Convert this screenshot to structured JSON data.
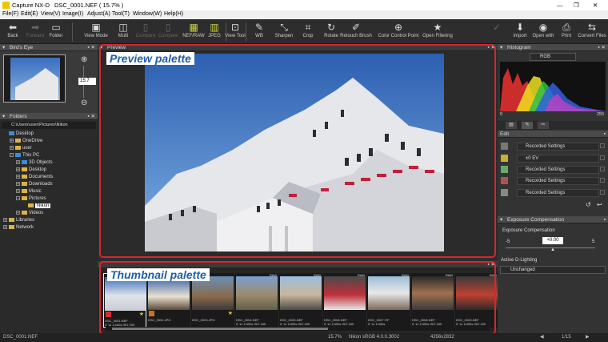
{
  "window": {
    "title": "Capture NX-D",
    "file_title": "DSC_0001.NEF ( 15.7% )",
    "controls": [
      "—",
      "❐",
      "✕"
    ]
  },
  "menu": [
    "File(F)",
    "Edit(E)",
    "View(V)",
    "Image(I)",
    "Adjust(A)",
    "Tool(T)",
    "Window(W)",
    "Help(H)"
  ],
  "toolbar": {
    "back": "Back",
    "forward": "Forward",
    "folder": "Folder",
    "view_mode": "View Mode",
    "multi": "Multi",
    "compare1": "Compare",
    "compare2": "Compare",
    "before_after": "NEF/RAW",
    "jpeg": "JPEG",
    "view_tool": "View Tool",
    "wb": "WB",
    "sharpen": "Sharpen",
    "crop": "Crop",
    "rotate": "Rotate",
    "retouch": "Retouch Brush",
    "color_control": "Color Control Point",
    "open_filtering": "Open Filtering",
    "import": "Import",
    "open_with": "Open with",
    "print": "Print",
    "convert": "Convert Files"
  },
  "birds_eye": {
    "title": "Bird's Eye",
    "zoom": "15.7"
  },
  "folders": {
    "title": "Folders",
    "path": "C:\\Users\\user\\Pictures\\Nikon",
    "tree": [
      {
        "label": "Desktop",
        "indent": 0,
        "exp": "",
        "blue": true
      },
      {
        "label": "OneDrive",
        "indent": 1,
        "exp": "+"
      },
      {
        "label": "user",
        "indent": 1,
        "exp": "+"
      },
      {
        "label": "This PC",
        "indent": 1,
        "exp": "−",
        "blue": true
      },
      {
        "label": "3D Objects",
        "indent": 2,
        "exp": "+",
        "blue": true
      },
      {
        "label": "Desktop",
        "indent": 2,
        "exp": "+"
      },
      {
        "label": "Documents",
        "indent": 2,
        "exp": "+"
      },
      {
        "label": "Downloads",
        "indent": 2,
        "exp": "+"
      },
      {
        "label": "Music",
        "indent": 2,
        "exp": "+"
      },
      {
        "label": "Pictures",
        "indent": 2,
        "exp": "−"
      },
      {
        "label": "Nikon",
        "indent": 3,
        "exp": "",
        "selected": true
      },
      {
        "label": "Videos",
        "indent": 2,
        "exp": "+"
      },
      {
        "label": "Libraries",
        "indent": 0,
        "exp": "+"
      },
      {
        "label": "Network",
        "indent": 0,
        "exp": "+"
      }
    ]
  },
  "preview": {
    "title": "Preview",
    "callout": "Preview palette"
  },
  "thumbnails": {
    "callout": "Thumbnail palette",
    "items": [
      {
        "name": "DSC_0001.NEF",
        "info": "0' 11 1/160s ISO 200",
        "raw": ""
      },
      {
        "name": "DSC_0002.JPG",
        "info": "",
        "raw": ""
      },
      {
        "name": "DSC_0003.JPG",
        "info": "",
        "raw": ""
      },
      {
        "name": "DSC_0004.NEF",
        "info": "0' 11 1/400s ISO 400",
        "raw": "RAW"
      },
      {
        "name": "DSC_0005.NEF",
        "info": "0' 11 1/400s ISO 400",
        "raw": "RAW"
      },
      {
        "name": "DSC_0006.NEF",
        "info": "0' 11 1/400s ISO 400",
        "raw": "RAW"
      },
      {
        "name": "DSC_0007.TIF",
        "info": "0' 11 1/400s",
        "raw": "RAW"
      },
      {
        "name": "DSC_0008.NEF",
        "info": "0' 11 1/400s ISO 400",
        "raw": "RAW"
      },
      {
        "name": "DSC_0009.NEF",
        "info": "0' 11 1/400s ISO 400",
        "raw": "RAW"
      }
    ]
  },
  "histogram": {
    "title": "Histogram",
    "channel": "RGB",
    "min": "0",
    "max": "255"
  },
  "edit": {
    "title": "Edit",
    "rows": [
      "Recorded Settings",
      "±0 EV",
      "Recorded Settings",
      "Recorded Settings",
      "Recorded Settings"
    ]
  },
  "exposure": {
    "title": "Exposure Compensation",
    "label": "Exposure Compensation",
    "value": "+0.00",
    "min": "-5",
    "zero": "0",
    "max": "5",
    "adl_label": "Active D-Lighting",
    "adl_value": "Unchanged"
  },
  "status": {
    "file": "DSC_0001.NEF",
    "zoom": "15.7%",
    "info": "Nikon sRGB 4.0.0.3002",
    "size": "4256x2832",
    "page": "1/15"
  },
  "colors": {
    "accent": "#d7262d",
    "callout_text": "#1f5fa6",
    "sky": "#2d5fb2"
  }
}
